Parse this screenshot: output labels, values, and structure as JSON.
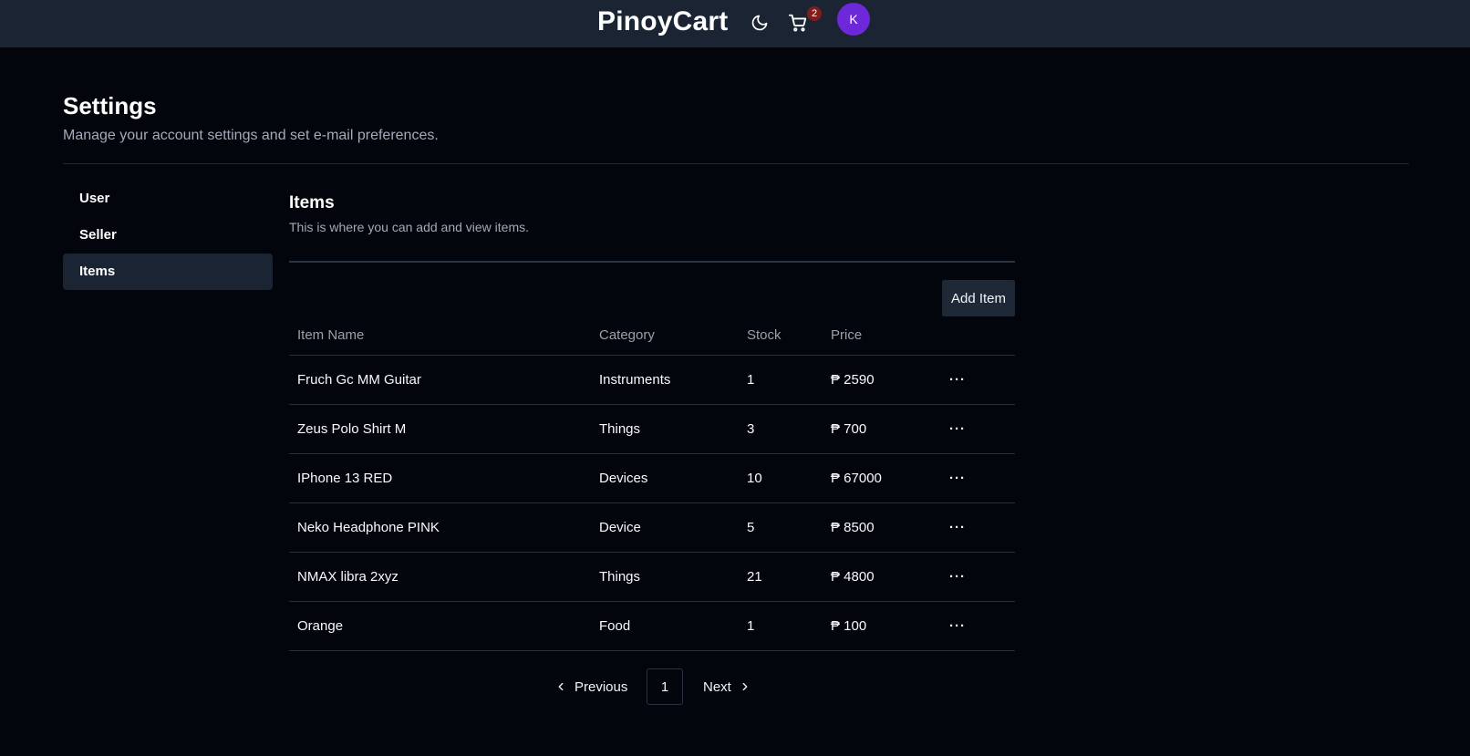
{
  "header": {
    "brand": "PinoyCart",
    "theme_icon": "moon-icon",
    "cart_icon": "cart-icon",
    "cart_count": "2",
    "avatar_initial": "K"
  },
  "page": {
    "title": "Settings",
    "description": "Manage your account settings and set e-mail preferences."
  },
  "sidebar": {
    "items": [
      {
        "label": "User",
        "active": false
      },
      {
        "label": "Seller",
        "active": false
      },
      {
        "label": "Items",
        "active": true
      }
    ]
  },
  "section": {
    "title": "Items",
    "description": "This is where you can add and view items.",
    "add_button": "Add Item"
  },
  "table": {
    "columns": [
      "Item Name",
      "Category",
      "Stock",
      "Price"
    ],
    "rows": [
      {
        "name": "Fruch Gc MM Guitar",
        "category": "Instruments",
        "stock": "1",
        "price": "₱ 2590"
      },
      {
        "name": "Zeus Polo Shirt M",
        "category": "Things",
        "stock": "3",
        "price": "₱ 700"
      },
      {
        "name": "IPhone 13 RED",
        "category": "Devices",
        "stock": "10",
        "price": "₱ 67000"
      },
      {
        "name": "Neko Headphone PINK",
        "category": "Device",
        "stock": "5",
        "price": "₱ 8500"
      },
      {
        "name": "NMAX libra 2xyz",
        "category": "Things",
        "stock": "21",
        "price": "₱ 4800"
      },
      {
        "name": "Orange",
        "category": "Food",
        "stock": "1",
        "price": "₱ 100"
      }
    ],
    "row_action": "···"
  },
  "pagination": {
    "previous": "Previous",
    "page": "1",
    "next": "Next"
  },
  "colors": {
    "background": "#03050d",
    "topbar": "#1a2433",
    "avatar": "#6d28d9",
    "badge": "#7f1d1d"
  }
}
